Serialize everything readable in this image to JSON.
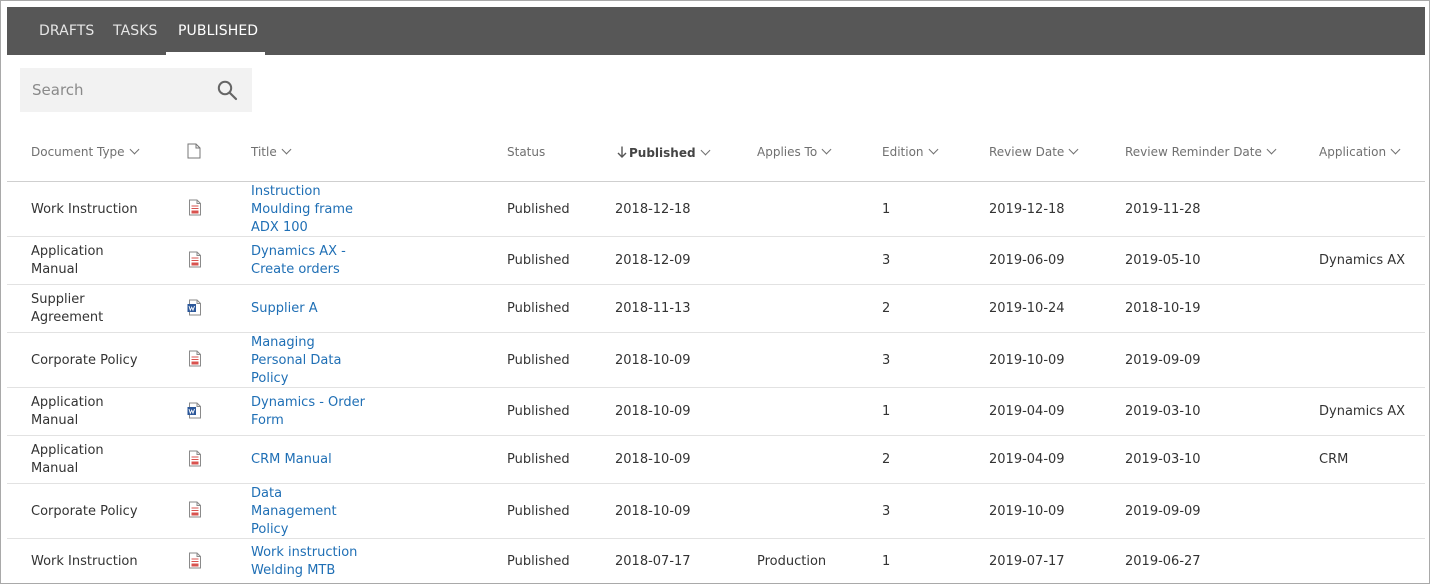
{
  "tabs": [
    {
      "label": "DRAFTS",
      "active": false
    },
    {
      "label": "TASKS",
      "active": false
    },
    {
      "label": "PUBLISHED",
      "active": true
    }
  ],
  "search": {
    "placeholder": "Search",
    "value": ""
  },
  "columns": {
    "document_type": "Document Type",
    "file": "",
    "title": "Title",
    "status": "Status",
    "published": "Published",
    "applies_to": "Applies To",
    "edition": "Edition",
    "review_date": "Review Date",
    "review_reminder_date": "Review Reminder Date",
    "application": "Application"
  },
  "sort": {
    "column": "published",
    "direction": "descending"
  },
  "colors": {
    "topbar": "#575757",
    "link": "#1f6fb5",
    "pdf_icon": "#d9534f",
    "word_icon": "#2b579a"
  },
  "rows": [
    {
      "doc_type": [
        "Work Instruction"
      ],
      "file_type": "pdf-icon",
      "title": [
        "Instruction",
        "Moulding frame",
        "ADX 100"
      ],
      "status": "Published",
      "published": "2018-12-18",
      "applies_to": "",
      "edition": "1",
      "review_date": "2019-12-18",
      "reminder_date": "2019-11-28",
      "application": ""
    },
    {
      "doc_type": [
        "Application",
        "Manual"
      ],
      "file_type": "pdf-icon",
      "title": [
        "Dynamics AX -",
        "Create orders"
      ],
      "status": "Published",
      "published": "2018-12-09",
      "applies_to": "",
      "edition": "3",
      "review_date": "2019-06-09",
      "reminder_date": "2019-05-10",
      "application": "Dynamics AX"
    },
    {
      "doc_type": [
        "Supplier",
        "Agreement"
      ],
      "file_type": "word-icon",
      "title": [
        "Supplier A"
      ],
      "status": "Published",
      "published": "2018-11-13",
      "applies_to": "",
      "edition": "2",
      "review_date": "2019-10-24",
      "reminder_date": "2018-10-19",
      "application": ""
    },
    {
      "doc_type": [
        "Corporate Policy"
      ],
      "file_type": "pdf-icon",
      "title": [
        "Managing",
        "Personal Data",
        "Policy"
      ],
      "status": "Published",
      "published": "2018-10-09",
      "applies_to": "",
      "edition": "3",
      "review_date": "2019-10-09",
      "reminder_date": "2019-09-09",
      "application": ""
    },
    {
      "doc_type": [
        "Application",
        "Manual"
      ],
      "file_type": "word-icon",
      "title": [
        "Dynamics - Order",
        "Form"
      ],
      "status": "Published",
      "published": "2018-10-09",
      "applies_to": "",
      "edition": "1",
      "review_date": "2019-04-09",
      "reminder_date": "2019-03-10",
      "application": "Dynamics AX"
    },
    {
      "doc_type": [
        "Application",
        "Manual"
      ],
      "file_type": "pdf-icon",
      "title": [
        "CRM Manual"
      ],
      "status": "Published",
      "published": "2018-10-09",
      "applies_to": "",
      "edition": "2",
      "review_date": "2019-04-09",
      "reminder_date": "2019-03-10",
      "application": "CRM"
    },
    {
      "doc_type": [
        "Corporate Policy"
      ],
      "file_type": "pdf-icon",
      "title": [
        "Data",
        "Management",
        "Policy"
      ],
      "status": "Published",
      "published": "2018-10-09",
      "applies_to": "",
      "edition": "3",
      "review_date": "2019-10-09",
      "reminder_date": "2019-09-09",
      "application": ""
    },
    {
      "doc_type": [
        "Work Instruction"
      ],
      "file_type": "pdf-icon",
      "title": [
        "Work instruction",
        "Welding MTB"
      ],
      "status": "Published",
      "published": "2018-07-17",
      "applies_to": "Production",
      "edition": "1",
      "review_date": "2019-07-17",
      "reminder_date": "2019-06-27",
      "application": ""
    }
  ]
}
